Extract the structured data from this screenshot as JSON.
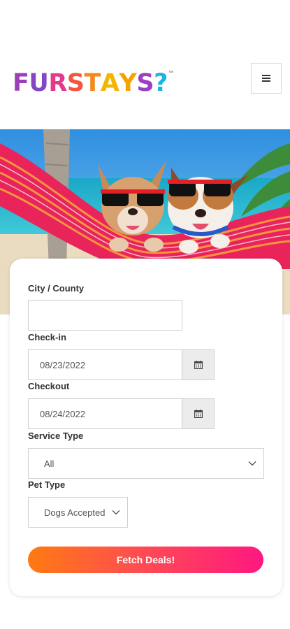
{
  "brand": {
    "logo_letters": [
      {
        "ch": "F",
        "color": "#9b3fb9"
      },
      {
        "ch": "U",
        "color": "#8446c5"
      },
      {
        "ch": "R",
        "color": "#e43a8c"
      },
      {
        "ch": "S",
        "color": "#f3563f"
      },
      {
        "ch": "T",
        "color": "#f48a1f"
      },
      {
        "ch": "A",
        "color": "#f6b400",
        "paw": true
      },
      {
        "ch": "Y",
        "color": "#f5a300"
      },
      {
        "ch": "S",
        "color": "#9c3fc4"
      },
      {
        "ch": "?",
        "color": "#19b6df"
      }
    ],
    "trademark": "™"
  },
  "header": {
    "menu_icon": "hamburger-icon"
  },
  "hero": {
    "image": "dogs-in-hammock-beach"
  },
  "form": {
    "city_label": "City / County",
    "city_value": "",
    "checkin_label": "Check-in",
    "checkin_value": "08/23/2022",
    "checkout_label": "Checkout",
    "checkout_value": "08/24/2022",
    "calendar_icon": "calendar-icon",
    "service_label": "Service Type",
    "service_value": "All",
    "pet_label": "Pet Type",
    "pet_value": "Dogs Accepted",
    "submit_label": "Fetch Deals!"
  },
  "colors": {
    "button_start": "#ff7a12",
    "button_end": "#ff1780",
    "date_button_bg": "#ececec"
  }
}
